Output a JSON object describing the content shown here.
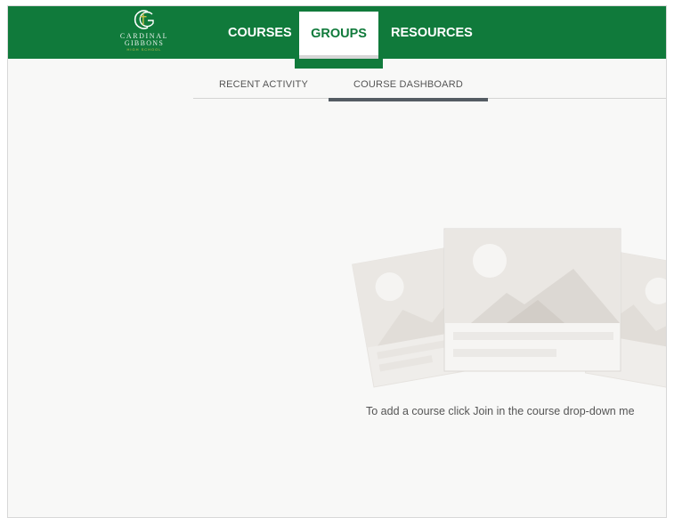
{
  "header": {
    "logo": {
      "line1": "CARDINAL",
      "line2": "GIBBONS",
      "line3": "HIGH SCHOOL"
    },
    "nav": [
      {
        "id": "courses",
        "label": "COURSES",
        "active": false
      },
      {
        "id": "groups",
        "label": "GROUPS",
        "active": true
      },
      {
        "id": "resources",
        "label": "RESOURCES",
        "active": false
      }
    ],
    "colors": {
      "brand_green": "#107a3b",
      "accent_gold": "#c9c04a"
    }
  },
  "subnav": {
    "tabs": [
      {
        "id": "recent",
        "label": "RECENT ACTIVITY",
        "active": false
      },
      {
        "id": "dashboard",
        "label": "COURSE DASHBOARD",
        "active": true
      }
    ]
  },
  "main": {
    "illustration_icon": "placeholder-cards-image-icon",
    "empty_message": "To add a course click Join in the course drop-down me"
  }
}
